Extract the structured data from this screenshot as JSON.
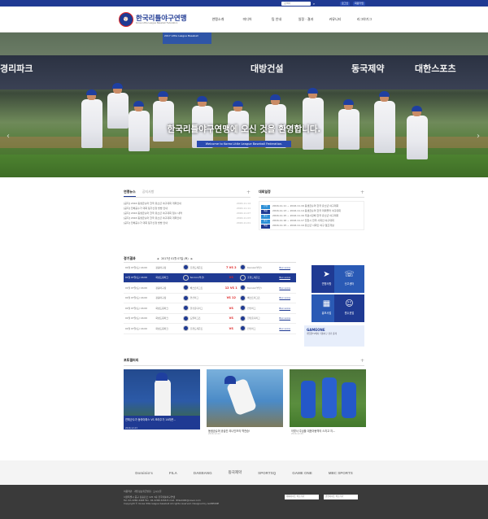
{
  "topbar": {
    "search_placeholder": "검색어",
    "btn_login": "로그인",
    "btn_join": "회원가입"
  },
  "brand": {
    "title": "한국리틀야구연맹",
    "subtitle": "Korea Little League Baseball Federation"
  },
  "nav": [
    "연맹소개",
    "미디어",
    "팀 안내",
    "일정 · 결과",
    "커뮤니티",
    "리그야기그"
  ],
  "hero": {
    "caption": "한국리틀야구연맹에 오신 것을 환영합니다.",
    "subcaption": "Welcome to Korea Little League Baseball Federation.",
    "board_left": "경리파크",
    "board_mid": "대방건설",
    "board_right1": "동국제약",
    "board_right2": "대한스포츠",
    "skybox": "2017 Little League Baseball"
  },
  "news": {
    "tab_active": "연맹뉴스",
    "tab_other": "공지사항",
    "items": [
      {
        "title": "[공지] 2016 동생균슈머 한국 유소년 야구대회 개최안내",
        "date": "2016.11.14"
      },
      {
        "title": "[공지] 전체공수가 대회 팀가산정 방법 안내",
        "date": "2016.11.11"
      },
      {
        "title": "[공지] 2016 동생균슈머 한국 유소년 야구대회 접수 내역",
        "date": "2016.11.07"
      },
      {
        "title": "[공지] 2016 동생균슈머 한국 유소년 야구대회 개최안내",
        "date": "2016.11.03"
      },
      {
        "title": "[공지] 전체공수가 대회 팀가산정 방법 안내",
        "date": "2016.11.01"
      }
    ]
  },
  "schedule": {
    "title": "대회일정",
    "items": [
      {
        "tag": "진행",
        "tag_color": "#2d8fd6",
        "text": "2016.11.11 ~ 2016.11.16  동생균슈머 한국 유소년 야구대회"
      },
      {
        "tag": "예정",
        "tag_color": "#1f3a93",
        "text": "2016.11.13 ~ 2016.11.14  동생균슈머 한국 파워폴라 야구대회"
      },
      {
        "tag": "종료",
        "tag_color": "#2d8fd6",
        "text": "2016.11.15 ~ 2016.11.16  우광시장배 한국 유소년 야구대회"
      },
      {
        "tag": "종료",
        "tag_color": "#2d8fd6",
        "text": "2016.11.16 ~ 2016.11.17  전천시 전국 사회인 야구대회"
      },
      {
        "tag": "예정",
        "tag_color": "#1f3a93",
        "text": "2016.11.15 ~ 2016.11.19  유소년 사회인 야구 캠프개설"
      }
    ]
  },
  "results": {
    "title": "경기결과",
    "date": "2017년 01월 07일 (토)",
    "games": [
      {
        "time": "01월 07일(토) 16:00",
        "place": "장충야구장",
        "home": "홍천드래곤즈",
        "score": "7 VS 2",
        "away": "Kocoon(부산)",
        "box": "Box score"
      },
      {
        "time": "01월 07일(토) 16:00",
        "place": "화성드림파크",
        "home": "Soccon(부산)",
        "score": "VS",
        "away": "홍천드래곤즈",
        "box": "Box score"
      },
      {
        "time": "01월 07일(토) 16:00",
        "place": "장충야구장",
        "home": "베스트리그즈",
        "score": "12 VS 1",
        "away": "Kocoon(부산)",
        "box": "Box score"
      },
      {
        "time": "01월 07일(토) 16:00",
        "place": "장충야구장",
        "home": "안산리그",
        "score": "VS 12",
        "away": "베스트리그즈",
        "box": "Box score"
      },
      {
        "time": "01월 07일(토) 16:00",
        "place": "화성드림파크",
        "home": "한강홈디리그",
        "score": "VS",
        "away": "안산리그",
        "box": "Box score"
      },
      {
        "time": "01월 07일(토) 16:00",
        "place": "화성드림파크",
        "home": "도원리그즈",
        "score": "VS",
        "away": "한강홈디리그",
        "box": "Box score"
      },
      {
        "time": "01월 07일(토) 16:00",
        "place": "화성드림파크",
        "home": "홍천드래곤즈",
        "score": "VS",
        "away": "안산리그",
        "box": "Box score"
      }
    ]
  },
  "quick": [
    {
      "label": "연맹사항",
      "icon": "➤"
    },
    {
      "label": "신고센터",
      "icon": "☏"
    },
    {
      "label": "홍보사업",
      "icon": "▦"
    },
    {
      "label": "원수표업",
      "icon": "☺"
    }
  ],
  "gameone": {
    "title": "GAMEONE",
    "text": "게임원TV에서 리틀야구 경기 중계"
  },
  "gallery": {
    "title": "포토갤러리",
    "items": [
      {
        "caption": "연체군수가 동라야파스 VS 조라주가 14라운...",
        "date": "2016.12.23"
      },
      {
        "caption": "동생균슈머 공습진 리나인즈의 역전승!",
        "date": "2016.12.22"
      },
      {
        "caption": "이렇사 주심을 대표아동역의 스지고 지...",
        "date": "2016.12.20"
      }
    ]
  },
  "sponsors": [
    "Dominio's",
    "FILA",
    "DAEBANG",
    "동국제약",
    "SPORTSQ",
    "GAME ONE",
    "MBC SPORTS"
  ],
  "footer": {
    "links": "이용약관 · 개인정보취급방침 · 오시는길",
    "addr": "서울특별시 중구 장충단로 125 3층 한국리틀야구연맹",
    "tel": "Tel. 02-2266-4448   Fax. 02-2268-3266   E-mail. little4400@naver.com",
    "copy": "Copyright © Korea little league baseball All rights reserved.  Designed by GAMEONE",
    "sel1": "대회사이트 바로가기",
    "sel2": "관련사이트 바로가기"
  }
}
